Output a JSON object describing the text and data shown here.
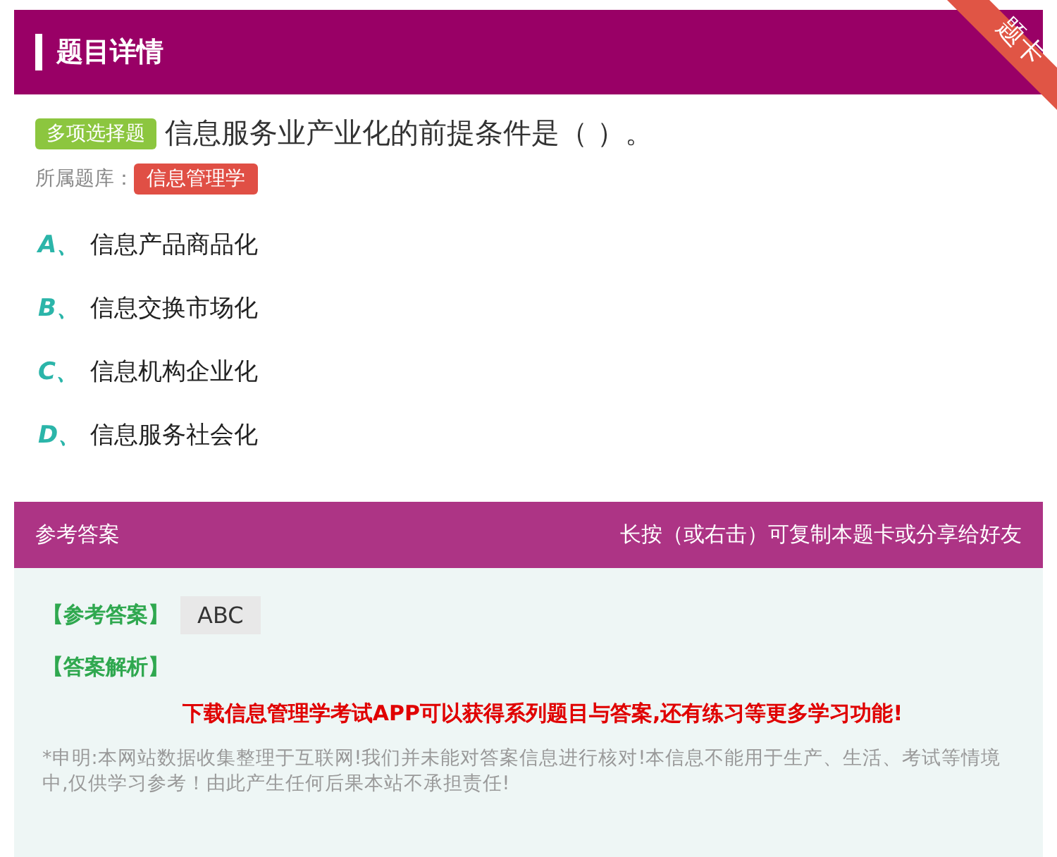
{
  "header": {
    "title": "题目详情",
    "ribbon": "题卡"
  },
  "question": {
    "type_tag": "多项选择题",
    "text": "信息服务业产业化的前提条件是（ ）。",
    "bank_label": "所属题库：",
    "bank": "信息管理学"
  },
  "options": [
    {
      "letter": "A、",
      "text": "信息产品商品化"
    },
    {
      "letter": "B、",
      "text": "信息交换市场化"
    },
    {
      "letter": "C、",
      "text": "信息机构企业化"
    },
    {
      "letter": "D、",
      "text": "信息服务社会化"
    }
  ],
  "answer_panel": {
    "title": "参考答案",
    "hint": "长按（或右击）可复制本题卡或分享给好友",
    "answer_label": "【参考答案】",
    "answer": "ABC",
    "analysis_label": "【答案解析】",
    "promo": "下载信息管理学考试APP可以获得系列题目与答案,还有练习等更多学习功能!",
    "disclaimer": "*申明:本网站数据收集整理于互联网!我们并未能对答案信息进行核对!本信息不能用于生产、生活、考试等情境中,仅供学习参考！由此产生任何后果本站不承担责任!"
  }
}
